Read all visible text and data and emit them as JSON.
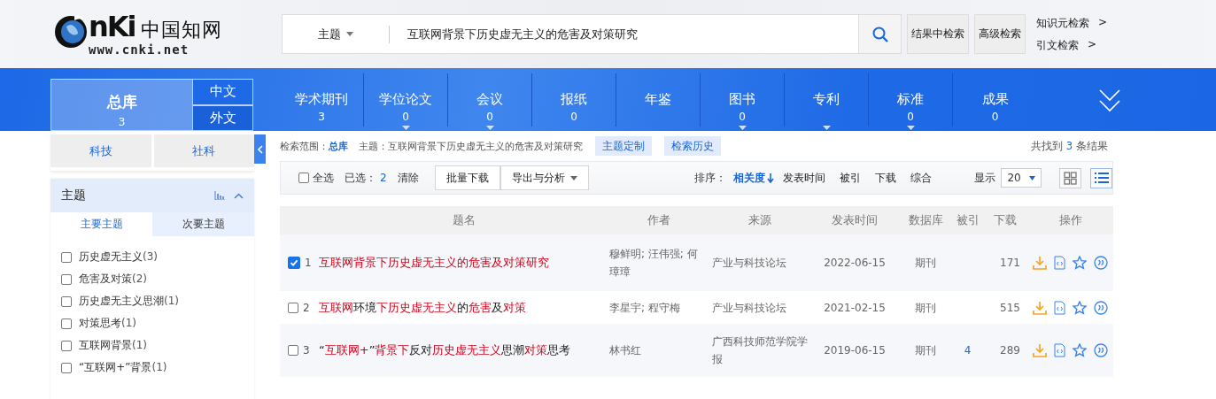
{
  "header": {
    "logo": {
      "mark": "nKi",
      "name": "中国知网",
      "url": "www.cnki.net"
    },
    "search": {
      "field": "主题",
      "value": "互联网背景下历史虚无主义的危害及对策研究"
    },
    "buttons": [
      "结果中检索",
      "高级检索"
    ],
    "links": [
      {
        "label": "知识元检索",
        "arrow": ">"
      },
      {
        "label": "引文检索",
        "arrow": ">"
      }
    ]
  },
  "nav": {
    "main": {
      "label": "总库",
      "count": "3"
    },
    "languages": [
      {
        "label": "中文",
        "selected": true
      },
      {
        "label": "外文",
        "selected": false
      }
    ],
    "categories": [
      {
        "label": "学术期刊",
        "count": "3",
        "dropdown": false
      },
      {
        "label": "学位论文",
        "count": "0",
        "dropdown": true
      },
      {
        "label": "会议",
        "count": "0",
        "dropdown": true
      },
      {
        "label": "报纸",
        "count": "0",
        "dropdown": false
      },
      {
        "label": "年鉴",
        "dropdown": false
      },
      {
        "label": "图书",
        "count": "0",
        "dropdown": true
      },
      {
        "label": "专利",
        "dropdown": true
      },
      {
        "label": "标准",
        "count": "0",
        "dropdown": true
      },
      {
        "label": "成果",
        "count": "0",
        "dropdown": false
      }
    ]
  },
  "sidebar": {
    "disciplines": [
      "科技",
      "社科"
    ],
    "facet": {
      "title": "主题",
      "tabs": [
        {
          "label": "主要主题",
          "selected": true
        },
        {
          "label": "次要主题",
          "selected": false
        }
      ],
      "items": [
        {
          "label": "历史虚无主义",
          "count": "(3)",
          "checked": false
        },
        {
          "label": "危害及对策",
          "count": "(2)",
          "checked": false
        },
        {
          "label": "历史虚无主义思潮",
          "count": "(1)",
          "checked": false
        },
        {
          "label": "对策思考",
          "count": "(1)",
          "checked": false
        },
        {
          "label": "互联网背景",
          "count": "(1)",
          "checked": false
        },
        {
          "label": "“互联网+”背景",
          "count": "(1)",
          "checked": false
        }
      ]
    }
  },
  "results": {
    "scope": {
      "label": "检索范围：",
      "value": "总库",
      "query_label": "主题：",
      "query": "互联网背景下历史虚无主义的危害及对策研究"
    },
    "scope_buttons": [
      "主题定制",
      "检索历史"
    ],
    "summary": {
      "prefix": "共找到",
      "count": "3",
      "suffix": "条结果"
    },
    "toolbar": {
      "select_all": {
        "label": "全选",
        "checked": false
      },
      "selected_label": "已选：",
      "selected_count": "2",
      "clear": "清除",
      "buttons": [
        {
          "label": "批量下载",
          "dropdown": false
        },
        {
          "label": "导出与分析",
          "dropdown": true
        }
      ],
      "sort_label": "排序：",
      "sort": [
        {
          "label": "相关度",
          "selected": true
        },
        {
          "label": "发表时间",
          "selected": false
        },
        {
          "label": "被引",
          "selected": false
        },
        {
          "label": "下载",
          "selected": false
        },
        {
          "label": "综合",
          "selected": false
        }
      ],
      "display_label": "显示",
      "display_value": "20",
      "views": [
        {
          "kind": "grid",
          "selected": false
        },
        {
          "kind": "list",
          "selected": true
        }
      ]
    },
    "table": {
      "columns": [
        "题名",
        "作者",
        "来源",
        "发表时间",
        "数据库",
        "被引",
        "下载",
        "操作"
      ],
      "rows": [
        {
          "checked": true,
          "number": "1",
          "title": [
            {
              "text": "互联网背景下历史虚无主义的危害及对策研究",
              "highlight": true
            }
          ],
          "authors": "穆鲜明; 汪伟强; 何璋璋",
          "source": "产业与科技论坛",
          "date": "2022-06-15",
          "database": "期刊",
          "cited": "",
          "downloads": "171"
        },
        {
          "checked": false,
          "number": "2",
          "title": [
            {
              "text": "互联网",
              "highlight": true
            },
            {
              "text": "环境",
              "highlight": false
            },
            {
              "text": "下历史虚无主义",
              "highlight": true
            },
            {
              "text": "的",
              "highlight": false
            },
            {
              "text": "危害",
              "highlight": true
            },
            {
              "text": "及",
              "highlight": false
            },
            {
              "text": "对策",
              "highlight": true
            }
          ],
          "authors": "李星宇; 程守梅",
          "source": "产业与科技论坛",
          "date": "2021-02-15",
          "database": "期刊",
          "cited": "",
          "downloads": "515"
        },
        {
          "checked": false,
          "number": "3",
          "title": [
            {
              "text": "“",
              "highlight": false
            },
            {
              "text": "互联网+",
              "highlight": true
            },
            {
              "text": "”",
              "highlight": false
            },
            {
              "text": "背景下",
              "highlight": true
            },
            {
              "text": "反对",
              "highlight": false
            },
            {
              "text": "历史虚无主义",
              "highlight": true
            },
            {
              "text": "思潮",
              "highlight": false
            },
            {
              "text": "对策",
              "highlight": true
            },
            {
              "text": "思考",
              "highlight": false
            }
          ],
          "authors": "林书红",
          "source": "广西科技师范学院学报",
          "date": "2019-06-15",
          "database": "期刊",
          "cited": "4",
          "downloads": "289"
        }
      ]
    }
  }
}
